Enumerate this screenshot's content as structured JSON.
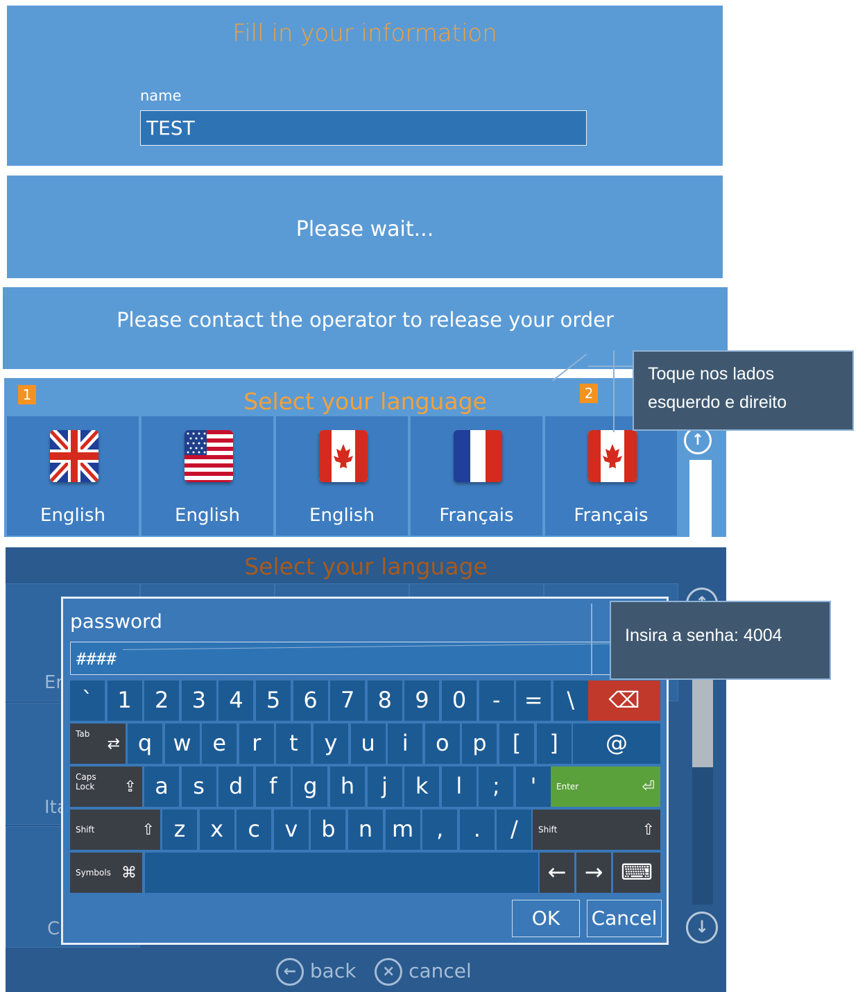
{
  "info_panel": {
    "title": "Fill in your information",
    "name_label": "name",
    "name_value": "TEST"
  },
  "wait_panel": {
    "message": "Please wait..."
  },
  "contact_panel": {
    "message": "Please contact the operator to release your order"
  },
  "language_panel": {
    "title": "Select your language",
    "badge_left": "1",
    "badge_right": "2",
    "languages": [
      {
        "label": "English",
        "flag": "uk-flag-icon"
      },
      {
        "label": "English",
        "flag": "us-flag-icon"
      },
      {
        "label": "English",
        "flag": "canada-flag-icon"
      },
      {
        "label": "Français",
        "flag": "france-flag-icon"
      },
      {
        "label": "Français",
        "flag": "canada-flag-icon"
      }
    ]
  },
  "callout_corners": {
    "text": "Toque nos lados esquerdo e direito"
  },
  "password_dialog": {
    "background_title": "Select your language",
    "background_labels": [
      "En",
      "Ita",
      "C"
    ],
    "label": "password",
    "value": "####",
    "ok": "OK",
    "cancel": "Cancel",
    "keyboard": {
      "row1": [
        "`",
        "1",
        "2",
        "3",
        "4",
        "5",
        "6",
        "7",
        "8",
        "9",
        "0",
        "-",
        "=",
        "\\"
      ],
      "row2": [
        "q",
        "w",
        "e",
        "r",
        "t",
        "y",
        "u",
        "i",
        "o",
        "p",
        "[",
        "]",
        "@"
      ],
      "row3": [
        "a",
        "s",
        "d",
        "f",
        "g",
        "h",
        "j",
        "k",
        "l",
        ";",
        "'"
      ],
      "row4": [
        "z",
        "x",
        "c",
        "v",
        "b",
        "n",
        "m",
        ",",
        ".",
        "/"
      ],
      "tab": "Tab",
      "caps": "Caps Lock",
      "enter": "Enter",
      "shift": "Shift",
      "symbols": "Symbols"
    }
  },
  "callout_password": {
    "text": "Insira a senha: 4004"
  },
  "footer_nav": {
    "back": "back",
    "cancel": "cancel"
  },
  "colors": {
    "panel_blue": "#5b9bd5",
    "title_orange": "#f4a13a",
    "badge_orange": "#f39221",
    "backspace_red": "#c0392b",
    "enter_green": "#5aa13b"
  }
}
